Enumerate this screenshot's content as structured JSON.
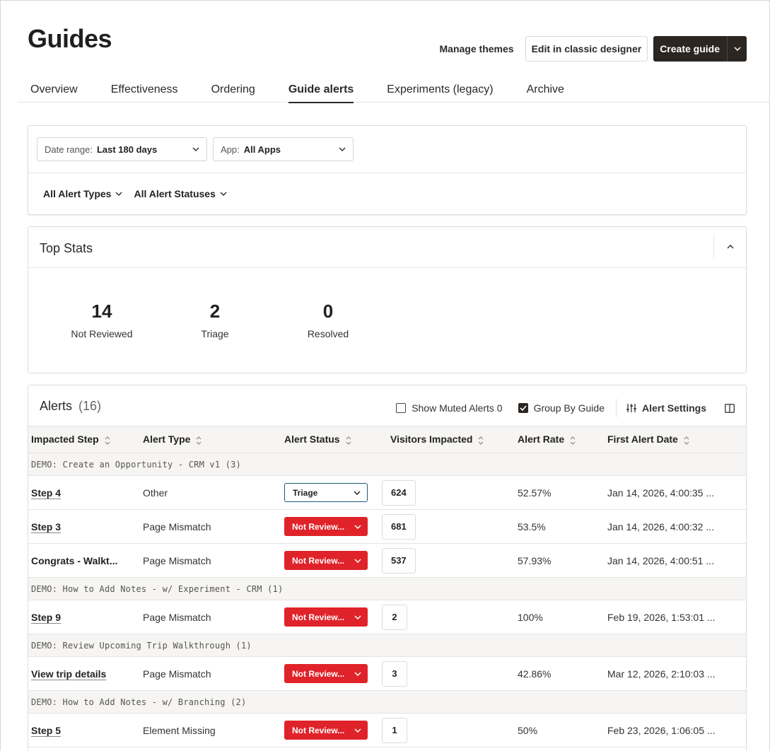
{
  "header": {
    "title": "Guides",
    "manage_themes": "Manage themes",
    "edit_classic": "Edit in classic designer",
    "create_guide": "Create guide"
  },
  "tabs": [
    {
      "label": "Overview"
    },
    {
      "label": "Effectiveness"
    },
    {
      "label": "Ordering"
    },
    {
      "label": "Guide alerts",
      "active": true
    },
    {
      "label": "Experiments (legacy)"
    },
    {
      "label": "Archive"
    }
  ],
  "filters": {
    "date_range": {
      "key": "Date range:",
      "value": "Last 180 days"
    },
    "app": {
      "key": "App:",
      "value": "All Apps"
    },
    "alert_types": "All Alert Types",
    "alert_statuses": "All Alert Statuses"
  },
  "top_stats": {
    "title": "Top Stats",
    "items": [
      {
        "value": "14",
        "label": "Not Reviewed"
      },
      {
        "value": "2",
        "label": "Triage"
      },
      {
        "value": "0",
        "label": "Resolved"
      }
    ]
  },
  "alerts": {
    "title": "Alerts",
    "count": "(16)",
    "show_muted": "Show Muted Alerts 0",
    "group_by_guide": "Group By Guide",
    "alert_settings": "Alert Settings",
    "columns": [
      "Impacted Step",
      "Alert Type",
      "Alert Status",
      "Visitors Impacted",
      "Alert Rate",
      "First Alert Date"
    ],
    "groups": [
      {
        "name": "DEMO: Create an Opportunity - CRM v1 (3)",
        "rows": [
          {
            "step": "Step 4",
            "type": "Other",
            "status": "Triage",
            "visitors": "624",
            "rate": "52.57%",
            "date": "Jan 14, 2026, 4:00:35 ..."
          },
          {
            "step": "Step 3",
            "type": "Page Mismatch",
            "status": "Not Review...",
            "visitors": "681",
            "rate": "53.5%",
            "date": "Jan 14, 2026, 4:00:32 ..."
          },
          {
            "step": "Congrats - Walkt...",
            "type": "Page Mismatch",
            "status": "Not Review...",
            "visitors": "537",
            "rate": "57.93%",
            "date": "Jan 14, 2026, 4:00:51 ..."
          }
        ]
      },
      {
        "name": "DEMO: How to Add Notes - w/ Experiment - CRM (1)",
        "rows": [
          {
            "step": "Step 9",
            "type": "Page Mismatch",
            "status": "Not Review...",
            "visitors": "2",
            "rate": "100%",
            "date": "Feb 19, 2026, 1:53:01 ..."
          }
        ]
      },
      {
        "name": "DEMO: Review Upcoming Trip Walkthrough (1)",
        "rows": [
          {
            "step": "View trip details",
            "type": "Page Mismatch",
            "status": "Not Review...",
            "visitors": "3",
            "rate": "42.86%",
            "date": "Mar 12, 2026, 2:10:03 ..."
          }
        ]
      },
      {
        "name": "DEMO: How to Add Notes - w/ Branching (2)",
        "rows": [
          {
            "step": "Step 5",
            "type": "Element Missing",
            "status": "Not Review...",
            "visitors": "1",
            "rate": "50%",
            "date": "Feb 23, 2026, 1:06:05 ..."
          }
        ]
      }
    ]
  },
  "colors": {
    "dark_button": "#2b2622",
    "not_reviewed_red": "#e0232a",
    "triage_border": "#1e5a7a",
    "table_header_bg": "#f6f5f3"
  }
}
